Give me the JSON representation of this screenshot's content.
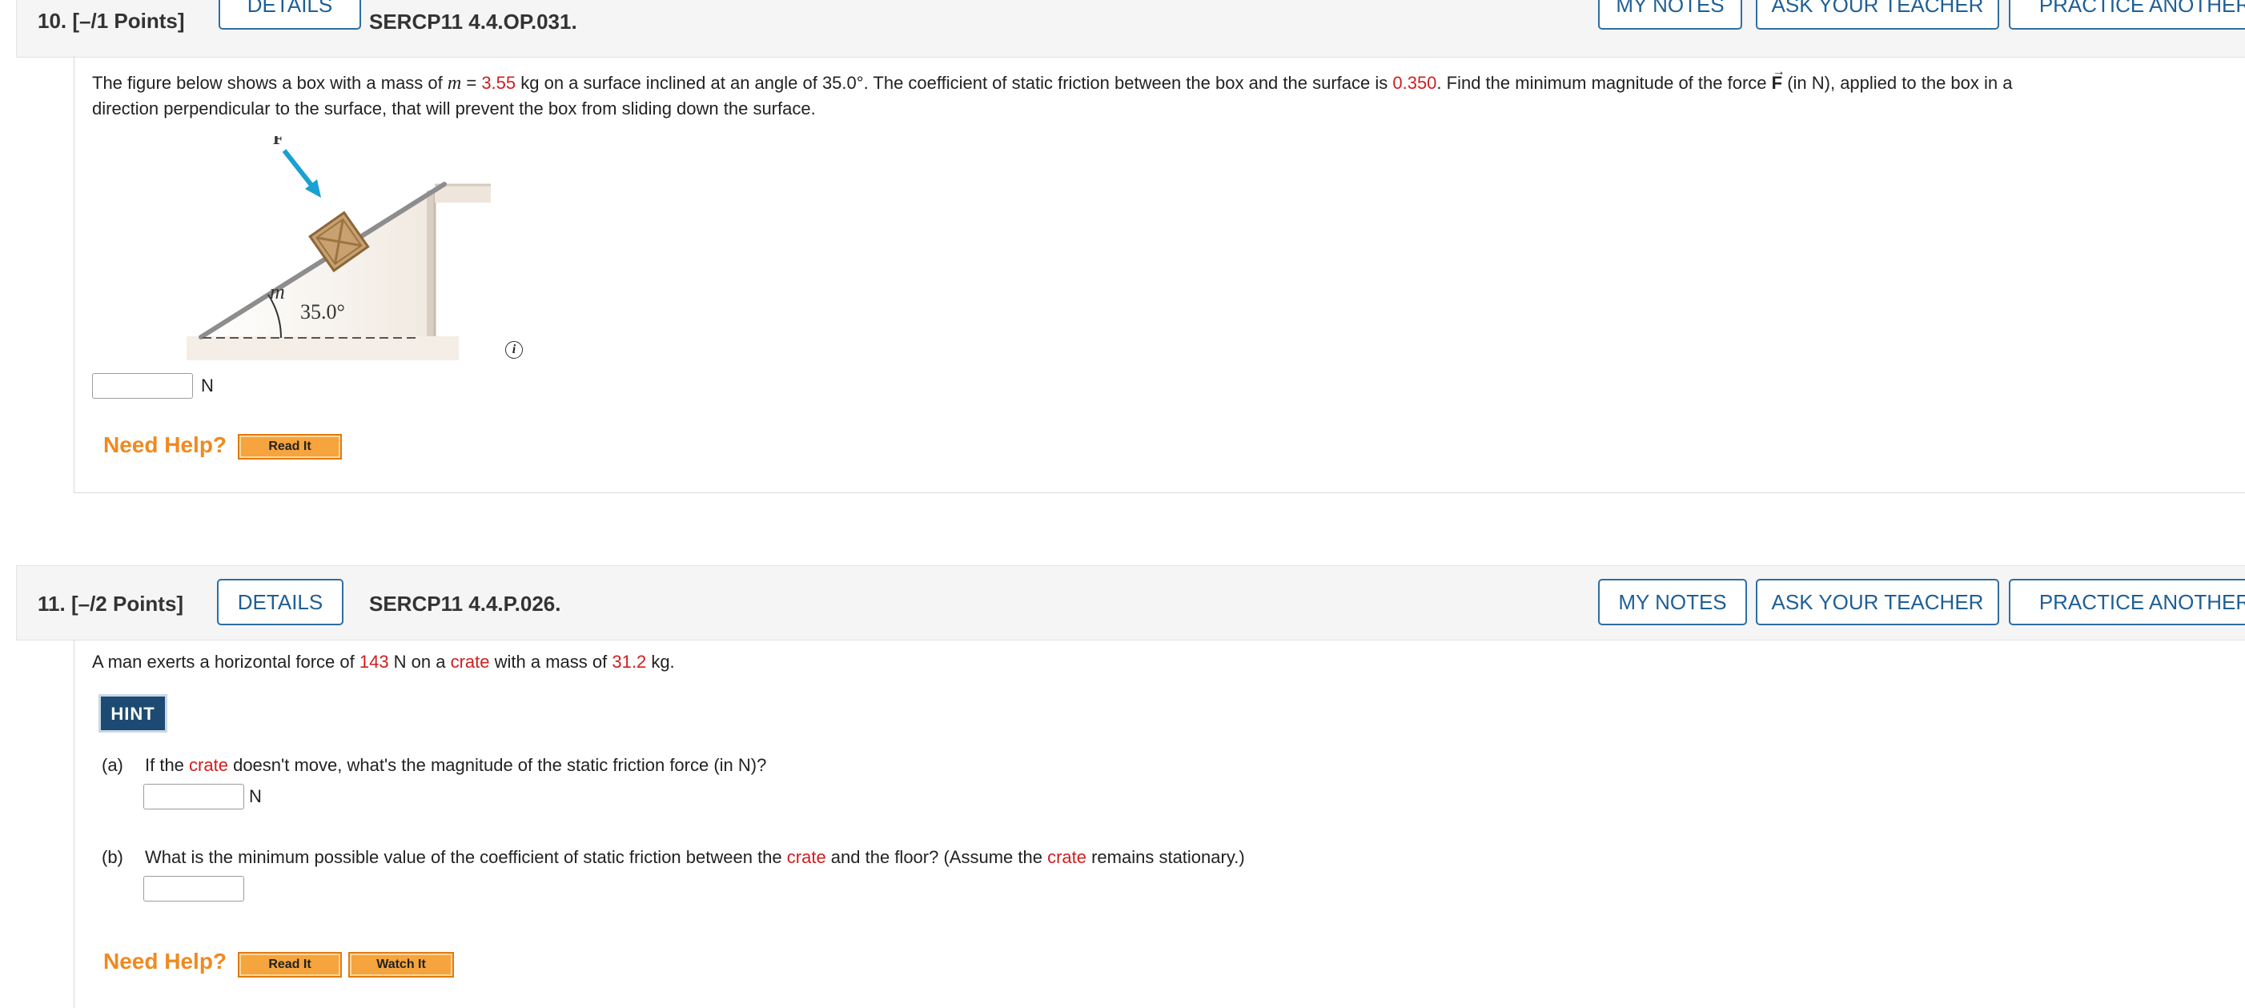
{
  "q10": {
    "number": "10.",
    "points": "[–/1 Points]",
    "details_label": "DETAILS",
    "code": "SERCP11 4.4.OP.031.",
    "my_notes": "MY NOTES",
    "ask_teacher": "ASK YOUR TEACHER",
    "practice_another": "PRACTICE ANOTHER",
    "text": {
      "part1": "The figure below shows a box with a mass of ",
      "m_symbol": "m",
      "part2": " = ",
      "mass": "3.55",
      "part3": " kg on a surface inclined at an angle of 35.0°. The coefficient of static friction between the box and the surface is ",
      "mu": "0.350",
      "part4": ". Find the minimum magnitude of the force ",
      "force_symbol": "F",
      "part5": " (in N), applied to the box in a",
      "line2": "direction perpendicular to the surface, that will prevent the box from sliding down the surface."
    },
    "figure": {
      "force_label": "F",
      "mass_label": "m",
      "angle_label": "35.0°"
    },
    "info_icon": "i",
    "answer_value": "",
    "unit": "N",
    "need_help": "Need Help?",
    "read_it": "Read It"
  },
  "q11": {
    "number": "11.",
    "points": "[–/2 Points]",
    "details_label": "DETAILS",
    "code": "SERCP11 4.4.P.026.",
    "my_notes": "MY NOTES",
    "ask_teacher": "ASK YOUR TEACHER",
    "practice_another": "PRACTICE ANOTHER",
    "text": {
      "part1": "A man exerts a horizontal force of ",
      "force": "143",
      "part2": " N on a ",
      "crate": "crate",
      "part3": " with a mass of ",
      "mass": "31.2",
      "part4": " kg."
    },
    "hint_label": "HINT",
    "a": {
      "label": "(a)",
      "part1": "If the ",
      "crate": "crate",
      "part2": " doesn't move, what's the magnitude of the static friction force (in N)?",
      "answer_value": "",
      "unit": "N"
    },
    "b": {
      "label": "(b)",
      "part1": "What is the minimum possible value of the coefficient of static friction between the ",
      "crate1": "crate",
      "part2": " and the floor? (Assume the ",
      "crate2": "crate",
      "part3": " remains stationary.)",
      "answer_value": ""
    },
    "need_help": "Need Help?",
    "read_it": "Read It",
    "watch_it": "Watch It"
  },
  "colors": {
    "link_blue": "#1f5f95",
    "highlight_red": "#d01e1e",
    "help_orange": "#f0891f",
    "hint_navy": "#1d4a72"
  }
}
